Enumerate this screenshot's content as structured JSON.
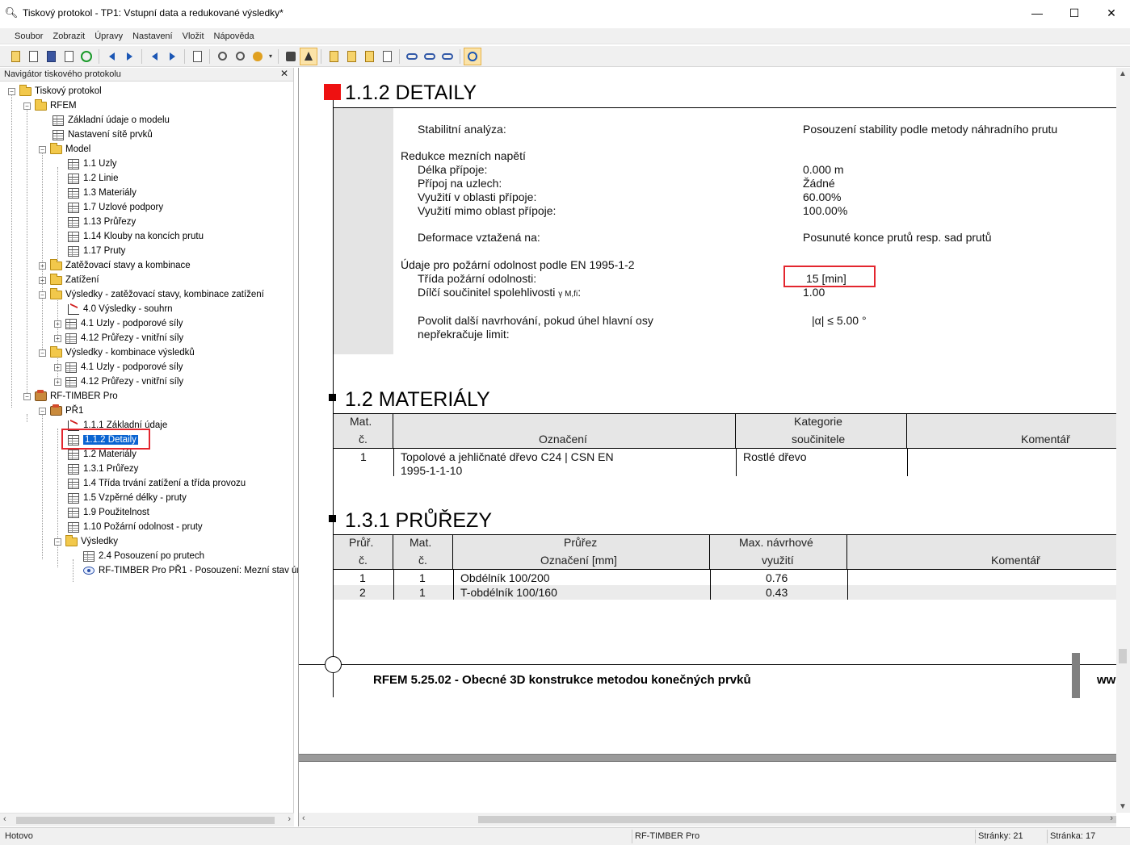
{
  "window": {
    "title": "Tiskový protokol - TP1: Vstupní data a redukované výsledky*",
    "minimize": "—",
    "maximize": "☐",
    "close": "✕"
  },
  "menu": [
    "Soubor",
    "Zobrazit",
    "Úpravy",
    "Nastavení",
    "Vložit",
    "Nápověda"
  ],
  "navigator": {
    "title": "Navigátor tiskového protokolu",
    "close": "✕",
    "items": [
      "Tiskový protokol",
      "RFEM",
      "Základní údaje o modelu",
      "Nastavení sítě prvků",
      "Model",
      "1.1 Uzly",
      "1.2 Linie",
      "1.3 Materiály",
      "1.7 Uzlové podpory",
      "1.13 Průřezy",
      "1.14 Klouby na koncích prutu",
      "1.17 Pruty",
      "Zatěžovací stavy a kombinace",
      "Zatížení",
      "Výsledky - zatěžovací stavy, kombinace zatížení",
      "4.0 Výsledky - souhrn",
      "4.1 Uzly - podporové síly",
      "4.12 Průřezy - vnitřní síly",
      "Výsledky - kombinace výsledků",
      "4.1 Uzly - podporové síly",
      "4.12 Průřezy - vnitřní síly",
      "RF-TIMBER Pro",
      "PŘ1",
      "1.1.1 Základní údaje",
      "1.1.2 Detaily",
      "1.2 Materiály",
      "1.3.1 Průřezy",
      "1.4 Třída trvání zatížení a třída provozu",
      "1.5 Vzpěrné délky - pruty",
      "1.9 Použitelnost",
      "1.10 Požární odolnost - pruty",
      "Výsledky",
      "2.4 Posouzení po prutech",
      "RF-TIMBER Pro PŘ1 - Posouzení: Mezní stav ún"
    ]
  },
  "doc": {
    "details": {
      "title": "1.1.2 DETAILY",
      "stability_label": "Stabilitní analýza:",
      "stability_value": "Posouzení stability podle metody náhradního prutu",
      "reduction_heading": "Redukce mezních napětí",
      "joint_length_label": "Délka přípoje:",
      "joint_length_value": "0.000 m",
      "joint_nodes_label": "Přípoj na uzlech:",
      "joint_nodes_value": "Žádné",
      "util_in_label": "Využití v oblasti přípoje:",
      "util_in_value": "60.00%",
      "util_out_label": "Využití mimo oblast přípoje:",
      "util_out_value": "100.00%",
      "deform_label": "Deformace vztažená na:",
      "deform_value": "Posunuté konce prutů resp. sad prutů",
      "fire_heading": "Údaje pro požární odolnost podle EN 1995-1-2",
      "fire_class_label": "Třída požární odolnosti:",
      "fire_class_value": "15 [min]",
      "partial_factor_label": "Dílčí součinitel spolehlivosti",
      "partial_factor_symbol": "γ M,fi",
      "partial_factor_colon": ":",
      "partial_factor_value": "1.00",
      "allow_label_1": "Povolit další navrhování, pokud úhel hlavní osy",
      "allow_label_2": "nepřekračuje limit:",
      "allow_value": "|α| ≤ 5.00 °"
    },
    "materials": {
      "title": "1.2 MATERIÁLY",
      "headers": [
        "Mat.",
        "č.",
        "Označení",
        "Kategorie",
        "součinitele",
        "Komentář"
      ],
      "rows": [
        {
          "no": "1",
          "name_1": "Topolové a jehličnaté dřevo C24 | CSN EN",
          "name_2": "1995-1-1-10",
          "category": "Rostlé dřevo",
          "comment": ""
        }
      ]
    },
    "sections": {
      "title": "1.3.1 PRŮŘEZY",
      "headers": [
        "Průř.",
        "č.",
        "Mat.",
        "č.",
        "Průřez",
        "Označení [mm]",
        "Max. návrhové",
        "využití",
        "Komentář"
      ],
      "rows": [
        {
          "no": "1",
          "mat": "1",
          "name": "Obdélník 100/200",
          "util": "0.76",
          "comment": ""
        },
        {
          "no": "2",
          "mat": "1",
          "name": "T-obdélník 100/160",
          "util": "0.43",
          "comment": ""
        }
      ]
    },
    "footer": {
      "text": "RFEM 5.25.02 - Obecné 3D konstrukce metodou konečných prvků",
      "right": "ww"
    }
  },
  "status": {
    "left": "Hotovo",
    "module": "RF-TIMBER Pro",
    "pages": "Stránky: 21",
    "page": "Stránka: 17"
  }
}
